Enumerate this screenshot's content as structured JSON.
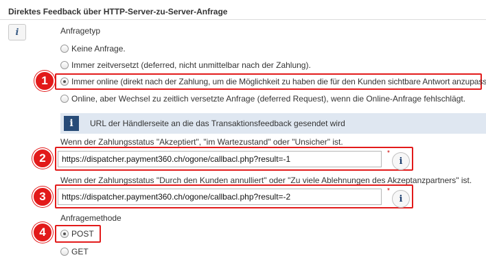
{
  "section": {
    "title": "Direktes Feedback über HTTP-Server-zu-Server-Anfrage"
  },
  "anfragetyp": {
    "label": "Anfragetyp",
    "options": [
      {
        "label": "Keine Anfrage.",
        "checked": false
      },
      {
        "label": "Immer zeitversetzt (deferred, nicht unmittelbar nach der Zahlung).",
        "checked": false
      },
      {
        "label": "Immer online (direkt nach der Zahlung, um die Möglichkeit zu haben die für den Kunden sichtbare Antwort anzupassen).",
        "checked": true
      },
      {
        "label": "Online, aber Wechsel zu zeitlich versetzte Anfrage (deferred Request), wenn die Online-Anfrage fehlschlägt.",
        "checked": false
      }
    ]
  },
  "info_banner": {
    "icon": "info-icon",
    "text": "URL der Händlerseite an die das Transaktionsfeedback gesendet wird"
  },
  "url_accepted": {
    "label": "Wenn der Zahlungsstatus \"Akzeptiert\", \"im Wartezustand\" oder \"Unsicher\" ist.",
    "value": "https://dispatcher.payment360.ch/ogone/callbacl.php?result=-1",
    "required_marker": "*"
  },
  "url_cancelled": {
    "label": "Wenn der Zahlungsstatus \"Durch den Kunden annulliert\" oder \"Zu viele Ablehnungen des Akzeptanzpartners\" ist.",
    "value": "https://dispatcher.payment360.ch/ogone/callbacl.php?result=-2",
    "required_marker": "*"
  },
  "anfragemethode": {
    "label": "Anfragemethode",
    "options": [
      {
        "label": "POST",
        "checked": true
      },
      {
        "label": "GET",
        "checked": false
      }
    ]
  },
  "badges": [
    "1",
    "2",
    "3",
    "4"
  ],
  "colors": {
    "annotation_red": "#e21a1a",
    "banner_bg": "#dfe7f1",
    "banner_icon_bg": "#274b78"
  }
}
